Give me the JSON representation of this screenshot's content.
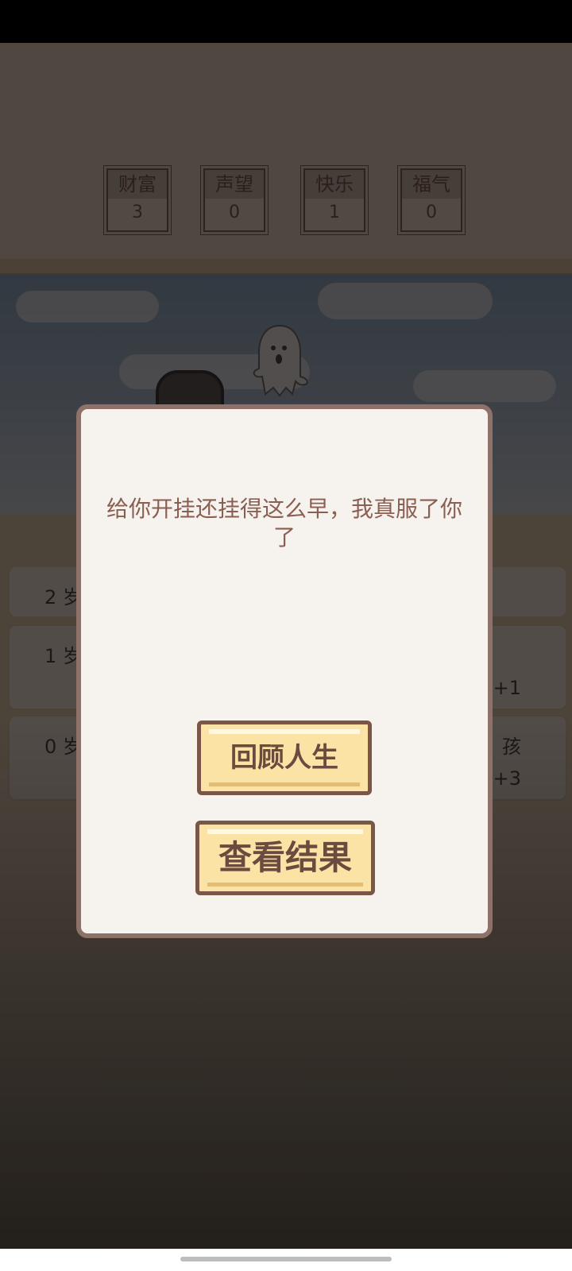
{
  "stats": [
    {
      "label": "财富",
      "value": "3"
    },
    {
      "label": "声望",
      "value": "0"
    },
    {
      "label": "快乐",
      "value": "1"
    },
    {
      "label": "福气",
      "value": "0"
    }
  ],
  "life_events": [
    {
      "age": "2 岁",
      "right_text": ""
    },
    {
      "age": "1 岁",
      "right_text": "+1"
    },
    {
      "age": "0 岁",
      "right_text_top": "孩",
      "right_text": "+3"
    }
  ],
  "dialog": {
    "message": "给你开挂还挂得这么早，我真服了你了",
    "review_button": "回顾人生",
    "result_button": "查看结果"
  }
}
